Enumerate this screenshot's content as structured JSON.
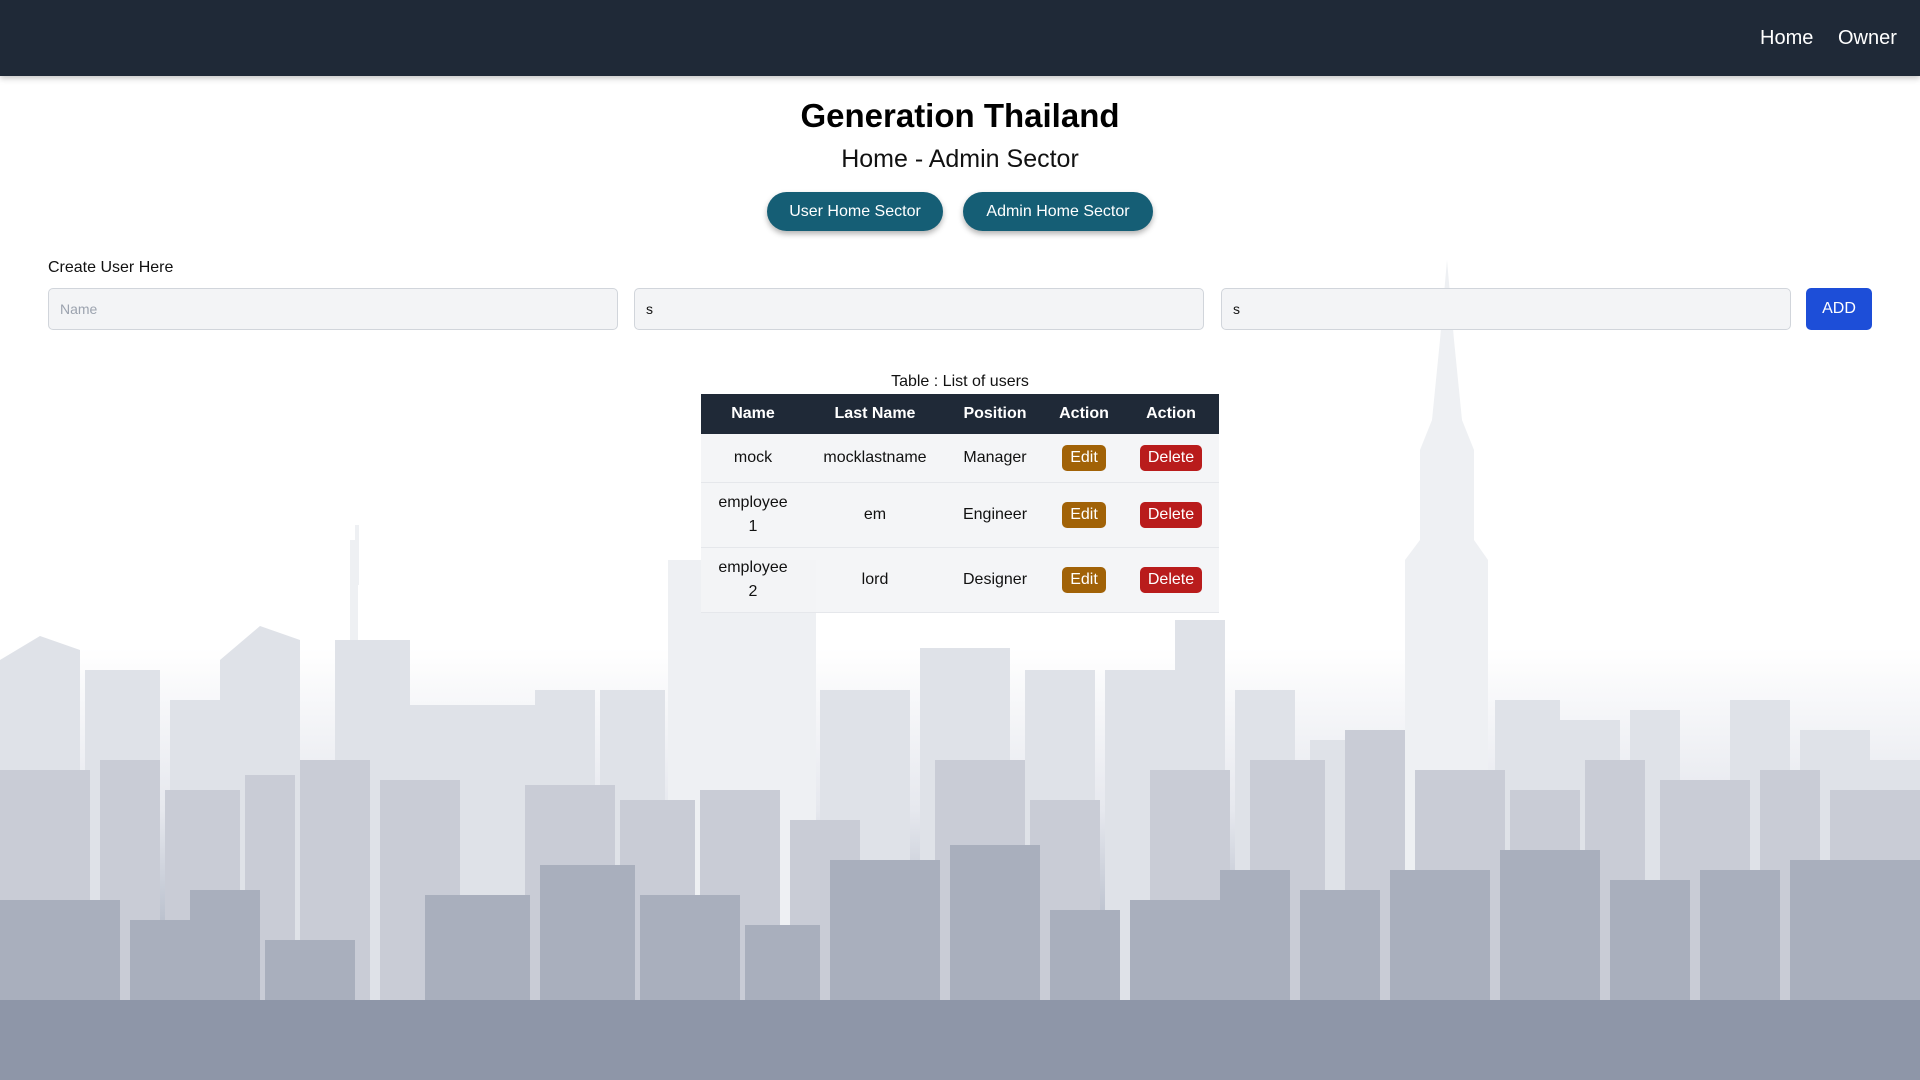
{
  "nav": {
    "links": [
      {
        "label": "Home"
      },
      {
        "label": "Owner"
      }
    ]
  },
  "header": {
    "title": "Generation Thailand",
    "subtitle": "Home - Admin Sector"
  },
  "sector_buttons": {
    "user": "User Home Sector",
    "admin": "Admin Home Sector"
  },
  "create_form": {
    "label": "Create User Here",
    "name": {
      "value": "",
      "placeholder": "Name"
    },
    "lastname": {
      "value": "s"
    },
    "position": {
      "value": "s"
    },
    "add_label": "ADD"
  },
  "table": {
    "caption": "Table : List of users",
    "headers": [
      "Name",
      "Last Name",
      "Position",
      "Action",
      "Action"
    ],
    "rows": [
      {
        "name": "mock",
        "lastname": "mocklastname",
        "position": "Manager",
        "edit": "Edit",
        "delete": "Delete"
      },
      {
        "name": "employee 1",
        "lastname": "em",
        "position": "Engineer",
        "edit": "Edit",
        "delete": "Delete"
      },
      {
        "name": "employee 2",
        "lastname": "lord",
        "position": "Designer",
        "edit": "Edit",
        "delete": "Delete"
      }
    ]
  },
  "colors": {
    "navbar": "#1f2937",
    "sector_button": "#155e75",
    "add_button": "#1d4ed8",
    "edit_button": "#a16207",
    "delete_button": "#b91c1c"
  }
}
